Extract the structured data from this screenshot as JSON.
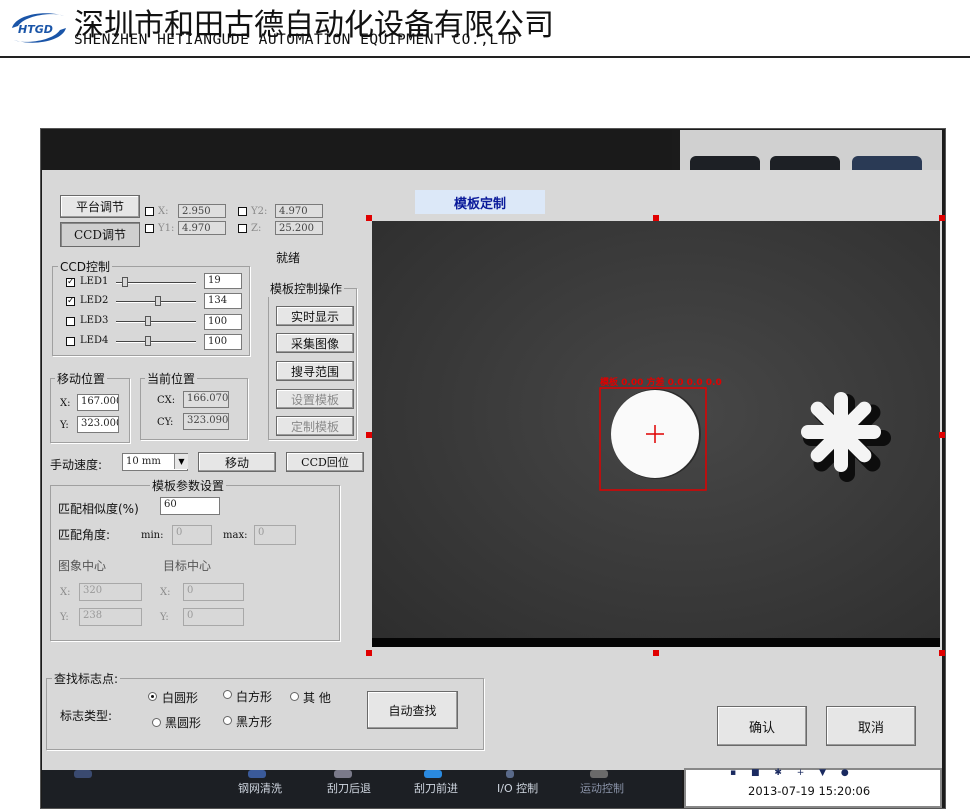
{
  "header": {
    "logo_text": "HTGD",
    "company_cn": "深圳市和田古德自动化设备有限公司",
    "company_en": "SHENZHEN HETIANGUDE AUTOMATION EQUIPMENT CO.,LTD"
  },
  "dialog": {
    "title": "模板定制",
    "tabs": {
      "platform": "平台调节",
      "ccd": "CCD调节"
    },
    "axes": [
      {
        "label": "X:",
        "value": "2.950"
      },
      {
        "label": "Y1:",
        "value": "4.970"
      },
      {
        "label": "Y2:",
        "value": "4.970"
      },
      {
        "label": "Z:",
        "value": "25.200"
      }
    ],
    "status": "就绪",
    "ccd_control": {
      "legend": "CCD控制",
      "leds": [
        {
          "label": "LED1",
          "checked": true,
          "value": "19",
          "level": 0.08
        },
        {
          "label": "LED2",
          "checked": true,
          "value": "134",
          "level": 0.53
        },
        {
          "label": "LED3",
          "checked": false,
          "value": "100",
          "level": 0.39
        },
        {
          "label": "LED4",
          "checked": false,
          "value": "100",
          "level": 0.39
        }
      ]
    },
    "template_ops": {
      "legend": "模板控制操作",
      "buttons": [
        "实时显示",
        "采集图像",
        "搜寻范围",
        "设置模板",
        "定制模板"
      ]
    },
    "move_position": {
      "legend": "移动位置",
      "x_label": "X:",
      "x": "167.000",
      "y_label": "Y:",
      "y": "323.000"
    },
    "current_position": {
      "legend": "当前位置",
      "cx_label": "CX:",
      "cx": "166.070",
      "cy_label": "CY:",
      "cy": "323.090"
    },
    "manual_speed": {
      "label": "手动速度:",
      "value": "10 mm",
      "move_button": "移动",
      "ccd_home_button": "CCD回位"
    },
    "template_params": {
      "legend": "模板参数设置",
      "similarity_label": "匹配相似度(%)",
      "similarity": "60",
      "angle_label": "匹配角度:",
      "min_label": "min:",
      "min": "0",
      "max_label": "max:",
      "max": "0",
      "image_center_label": "图象中心",
      "target_center_label": "目标中心",
      "img_x_label": "X:",
      "img_x": "320",
      "img_y_label": "Y:",
      "img_y": "238",
      "tgt_x_label": "X:",
      "tgt_x": "0",
      "tgt_y_label": "Y:",
      "tgt_y": "0"
    },
    "find_mark": {
      "legend": "查找标志点:",
      "type_label": "标志类型:",
      "options": [
        {
          "label": "白圆形",
          "selected": true
        },
        {
          "label": "白方形",
          "selected": false
        },
        {
          "label": "其 他",
          "selected": false
        },
        {
          "label": "黑圆形",
          "selected": false
        },
        {
          "label": "黑方形",
          "selected": false
        }
      ],
      "auto_find_button": "自动查找"
    },
    "confirm_button": "确认",
    "cancel_button": "取消",
    "camera": {
      "overlay_text": "模板 0.00 方差 0.0 0.0 0.0"
    }
  },
  "taskbar": {
    "items": [
      "钢网清洗",
      "刮刀后退",
      "刮刀前进",
      "I/O 控制",
      "运动控制"
    ],
    "datetime": "2013-07-19  15:20:06"
  },
  "colors": {
    "dialog_bg": "#d8d8d8",
    "title_bg": "#dce8f8",
    "title_text": "#0a1a9a",
    "roi_red": "#e00000",
    "camera_bg": "#3a3a3a"
  }
}
